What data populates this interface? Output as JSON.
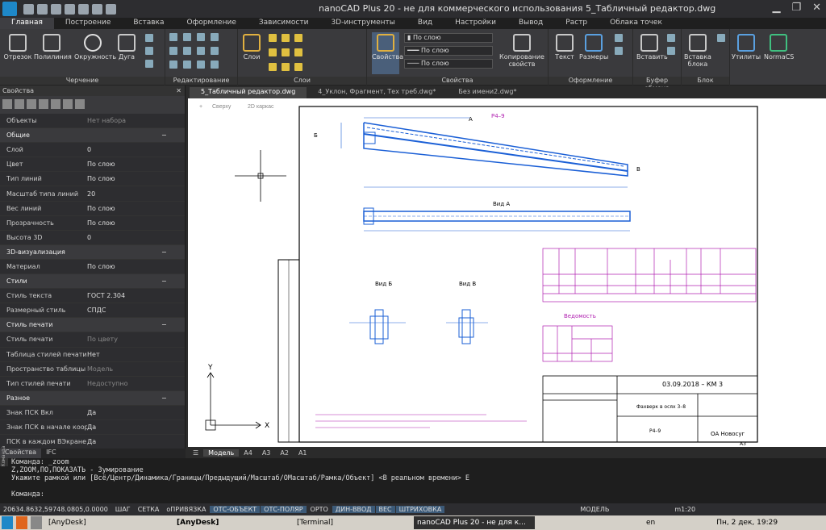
{
  "app": {
    "title": "nanoCAD Plus 20 - не для коммерческого использования 5_Табличный редактор.dwg"
  },
  "ribbon_tabs": [
    "Главная",
    "Построение",
    "Вставка",
    "Оформление",
    "Зависимости",
    "3D-инструменты",
    "Вид",
    "Настройки",
    "Вывод",
    "Растр",
    "Облака точек"
  ],
  "ribbon": {
    "draw": {
      "label": "Черчение",
      "items": [
        "Отрезок",
        "Полилиния",
        "Окружность",
        "Дуга"
      ]
    },
    "edit": {
      "label": "Редактирование"
    },
    "layers": {
      "label": "Слои",
      "button": "Слои"
    },
    "props": {
      "label": "Свойства",
      "button": "Свойства",
      "layer_val": "По слою",
      "line1": "По слою",
      "line2": "По слою",
      "copy": "Копирование свойств"
    },
    "format": {
      "label": "Оформление",
      "items": [
        "Текст",
        "Размеры"
      ]
    },
    "clip": {
      "label": "Буфер обмена",
      "item": "Вставить"
    },
    "block": {
      "label": "Блок",
      "item": "Вставка блока"
    },
    "util": {
      "item": "Утилиты"
    },
    "normacs": {
      "item": "NormaCS"
    }
  },
  "props_panel": {
    "title": "Свойства",
    "rows": [
      {
        "k": "Объекты",
        "v": "Нет набора",
        "gray": true
      },
      {
        "k": "Общие",
        "sec": true
      },
      {
        "k": "Слой",
        "v": "0"
      },
      {
        "k": "Цвет",
        "v": "По слою"
      },
      {
        "k": "Тип линий",
        "v": "По слою"
      },
      {
        "k": "Масштаб типа линий",
        "v": "20"
      },
      {
        "k": "Вес линий",
        "v": "По слою"
      },
      {
        "k": "Прозрачность",
        "v": "По слою"
      },
      {
        "k": "Высота 3D",
        "v": "0"
      },
      {
        "k": "3D-визуализация",
        "sec": true
      },
      {
        "k": "Материал",
        "v": "По слою"
      },
      {
        "k": "Стили",
        "sec": true
      },
      {
        "k": "Стиль текста",
        "v": "ГОСТ 2.304"
      },
      {
        "k": "Размерный стиль",
        "v": "СПДС"
      },
      {
        "k": "Стиль печати",
        "sec": true
      },
      {
        "k": "Стиль печати",
        "v": "По цвету",
        "gray": true
      },
      {
        "k": "Таблица стилей печати",
        "v": "Нет"
      },
      {
        "k": "Пространство таблицы ст...",
        "v": "Модель",
        "gray": true
      },
      {
        "k": "Тип стилей печати",
        "v": "Недоступно",
        "gray": true
      },
      {
        "k": "Разное",
        "sec": true
      },
      {
        "k": "Знак ПСК Вкл",
        "v": "Да"
      },
      {
        "k": "Знак ПСК в начале коорд...",
        "v": "Да"
      },
      {
        "k": "ПСК в каждом ВЭкране",
        "v": "Да"
      }
    ],
    "bottom_tabs": [
      "Свойства",
      "IFC"
    ]
  },
  "doc_tabs": [
    "5_Табличный редактор.dwg",
    "4_Уклон, Фрагмент, Тех треб.dwg*",
    "Без имени2.dwg*"
  ],
  "view": {
    "plus": "+",
    "view": "Сверху",
    "mode": "2D каркас"
  },
  "layout_tabs": [
    "Модель",
    "А4",
    "А3",
    "А2",
    "А1"
  ],
  "drawing": {
    "mark": "Р4–9",
    "view_a": "Вид А",
    "view_b": "Вид Б",
    "view_c": "Вид В",
    "table_title": "Ведомость",
    "stamp_code": "03.09.2018 – КМ 3",
    "stamp_name": "Фахверк в осях 3–8",
    "stamp_sheet": "Р4–9",
    "stamp_org": "ОА Новосуг",
    "stamp_format": "А3",
    "label_a": "А",
    "label_b": "Б",
    "label_v": "В"
  },
  "command": {
    "lines": [
      "Команда: _zoom",
      "Z,ZOOM,ПО,ПОКАЗАТЬ - Зумирование",
      "Укажите рамкой или [Всё/Центр/Динамика/Границы/Предыдущий/Масштаб/ОМасштаб/Рамка/Объект] <В реальном времени> Е",
      "",
      "Команда:"
    ],
    "side": "Команда"
  },
  "status": {
    "coords": "20634.8632,59748.0805,0.0000",
    "buttons": [
      {
        "t": "ШАГ",
        "on": false
      },
      {
        "t": "СЕТКА",
        "on": false
      },
      {
        "t": "оПРИВЯЗКА",
        "on": false
      },
      {
        "t": "ОТС-ОБЪЕКТ",
        "on": true
      },
      {
        "t": "ОТС-ПОЛЯР",
        "on": true
      },
      {
        "t": "ОРТО",
        "on": false
      },
      {
        "t": "ДИН-ВВОД",
        "on": true
      },
      {
        "t": "ВЕС",
        "on": true
      },
      {
        "t": "ШТРИХОВКА",
        "on": true
      }
    ],
    "model": "МОДЕЛЬ",
    "scale": "m1:20"
  },
  "taskbar": {
    "items": [
      "[AnyDesk]",
      "[AnyDesk]",
      "[Terminal]",
      "nanoCAD Plus 20 - не для к..."
    ],
    "lang": "en",
    "clock": "Пн, 2 дек, 19:29"
  }
}
